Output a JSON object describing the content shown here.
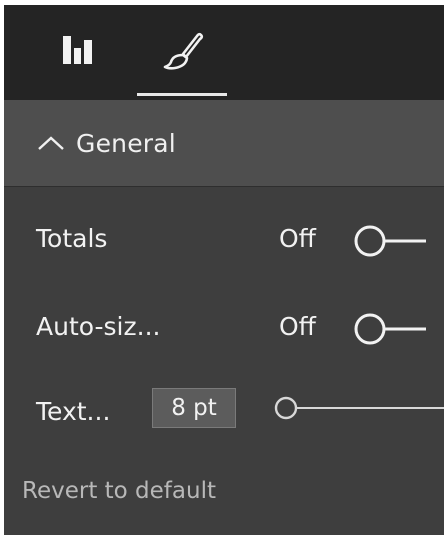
{
  "tabs": [
    {
      "icon": "bar-chart-icon",
      "active": false
    },
    {
      "icon": "paint-brush-icon",
      "active": true
    }
  ],
  "section": {
    "title": "General",
    "expanded": true
  },
  "settings": {
    "totals": {
      "label": "Totals",
      "state": "Off",
      "on": false
    },
    "auto_size": {
      "label": "Auto-siz...",
      "state": "Off",
      "on": false
    },
    "text_size": {
      "label": "Text...",
      "value": "8 pt",
      "slider_position": 0
    }
  },
  "revert_label": "Revert to default",
  "colors": {
    "panel": "#3e3e3e",
    "top_bar": "#242424",
    "header": "#4e4e4e",
    "text": "#f2f2f2"
  }
}
